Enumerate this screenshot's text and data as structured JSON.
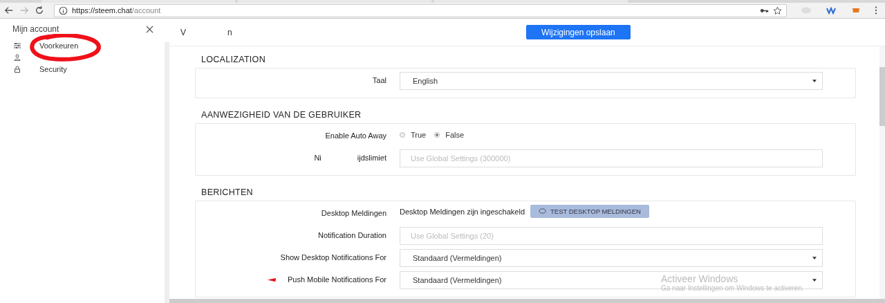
{
  "browser": {
    "url_host": "https://steem.chat",
    "url_path": "/account"
  },
  "sidebar": {
    "title": "Mijn account",
    "items": [
      {
        "kind": "prefs",
        "label": "Voorkeuren"
      },
      {
        "kind": "profile"
      },
      {
        "kind": "security",
        "label": "Security"
      }
    ]
  },
  "header": {
    "title_parts": [
      "V",
      "n"
    ],
    "save_button": "Wijzigingen opslaan"
  },
  "sections": [
    {
      "title": "LOCALIZATION",
      "rows": [
        {
          "kind": "select",
          "label": "Taal",
          "value": "English"
        }
      ]
    },
    {
      "title": "AANWEZIGHEID VAN DE GEBRUIKER",
      "rows": [
        {
          "kind": "radio",
          "label": "Enable Auto Away",
          "options": [
            {
              "label": "True",
              "selected": false
            },
            {
              "label": "False",
              "selected": true
            }
          ]
        },
        {
          "kind": "input",
          "label_parts": [
            "Ni",
            "ijdslimiet"
          ],
          "placeholder": "Use Global Settings (300000)"
        }
      ]
    },
    {
      "title": "BERICHTEN",
      "rows": [
        {
          "kind": "status",
          "label": "Desktop Meldingen",
          "text": "Desktop Meldingen zijn ingeschakeld",
          "button": "TEST DESKTOP MELDINGEN"
        },
        {
          "kind": "input",
          "label": "Notification Duration",
          "placeholder": "Use Global Settings (20)"
        },
        {
          "kind": "select",
          "label": "Show Desktop Notifications For",
          "value": "Standaard (Vermeldingen)"
        },
        {
          "kind": "select",
          "label": "Push Mobile Notifications For",
          "value": "Standaard (Vermeldingen)"
        }
      ]
    }
  ],
  "os_overlay": {
    "title": "Activeer Windows",
    "text": "Ga naar Instellingen om Windows te activeren."
  }
}
